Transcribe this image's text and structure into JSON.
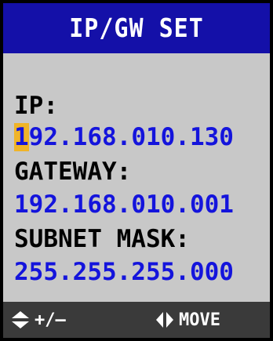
{
  "header": {
    "title": "IP/GW SET"
  },
  "fields": {
    "ip": {
      "label": "IP:",
      "value_cursor_char": "1",
      "value_rest": "92.168.010.130"
    },
    "gateway": {
      "label": "GATEWAY:",
      "value": "192.168.010.001"
    },
    "subnet": {
      "label": "SUBNET MASK:",
      "value": "255.255.255.000"
    }
  },
  "footer": {
    "adjust": {
      "icon": "up-down-arrows-icon",
      "label": "+/—"
    },
    "move": {
      "icon": "left-right-arrows-icon",
      "label": "MOVE"
    }
  },
  "colors": {
    "header_bg": "#1410a8",
    "screen_bg": "#c8c8c8",
    "value_text": "#1414dc",
    "cursor_bg": "#f0b428",
    "footer_bg": "#3a3a3a"
  }
}
